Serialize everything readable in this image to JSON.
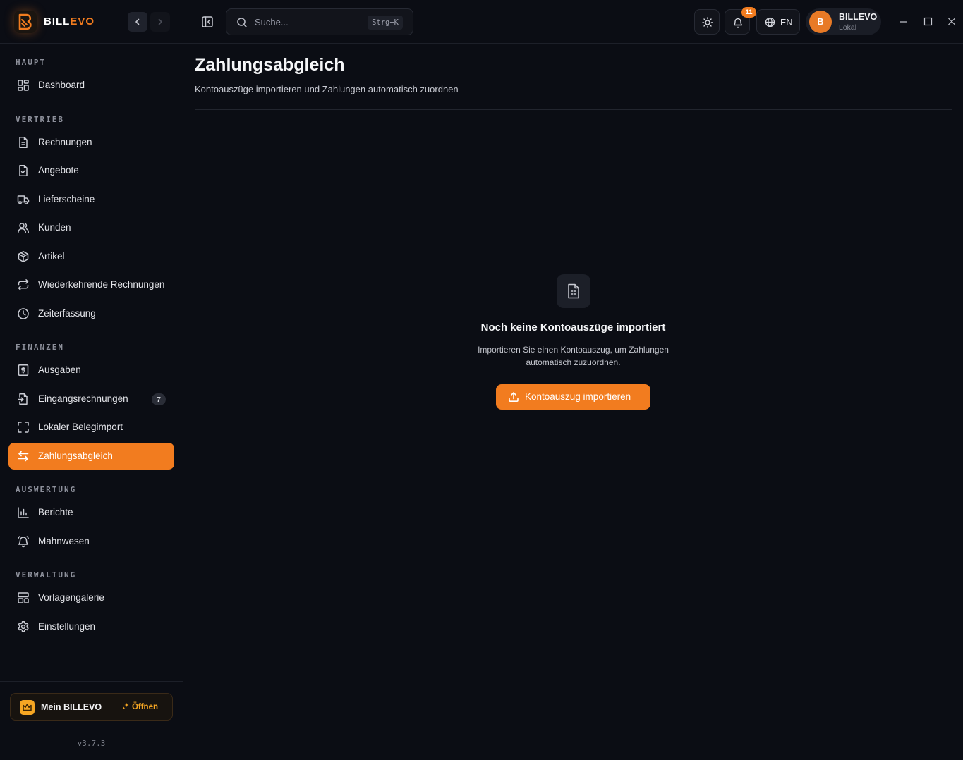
{
  "brand": {
    "part1": "BILL",
    "part2": "EVO"
  },
  "search": {
    "placeholder": "Suche...",
    "shortcut": "Strg+K"
  },
  "topbar": {
    "notifications_count": "11",
    "language": "EN",
    "user": {
      "initial": "B",
      "name": "BILLEVO",
      "subtitle": "Lokal"
    }
  },
  "sidebar": {
    "sections": {
      "haupt": "HAUPT",
      "vertrieb": "VERTRIEB",
      "finanzen": "FINANZEN",
      "auswertung": "AUSWERTUNG",
      "verwaltung": "VERWALTUNG"
    },
    "items": {
      "dashboard": "Dashboard",
      "rechnungen": "Rechnungen",
      "angebote": "Angebote",
      "lieferscheine": "Lieferscheine",
      "kunden": "Kunden",
      "artikel": "Artikel",
      "wiederkehrende": "Wiederkehrende Rechnungen",
      "zeiterfassung": "Zeiterfassung",
      "ausgaben": "Ausgaben",
      "eingangsrechnungen": "Eingangsrechnungen",
      "eingangsrechnungen_count": "7",
      "belegimport": "Lokaler Belegimport",
      "zahlungsabgleich": "Zahlungsabgleich",
      "berichte": "Berichte",
      "mahnwesen": "Mahnwesen",
      "vorlagengalerie": "Vorlagengalerie",
      "einstellungen": "Einstellungen"
    },
    "active_item": "Zahlungsabgleich",
    "mein": {
      "label": "Mein BILLEVO",
      "open": "Öffnen"
    },
    "version": "v3.7.3"
  },
  "main": {
    "title": "Zahlungsabgleich",
    "subtitle": "Kontoauszüge importieren und Zahlungen automatisch zuordnen",
    "empty_state": {
      "title": "Noch keine Kontoauszüge importiert",
      "text": "Importieren Sie einen Kontoauszug, um Zahlungen automatisch zuzuordnen.",
      "button": "Kontoauszug importieren"
    }
  },
  "colors": {
    "accent": "#f27c1f",
    "background": "#0b0d14",
    "panel": "#12141b"
  }
}
